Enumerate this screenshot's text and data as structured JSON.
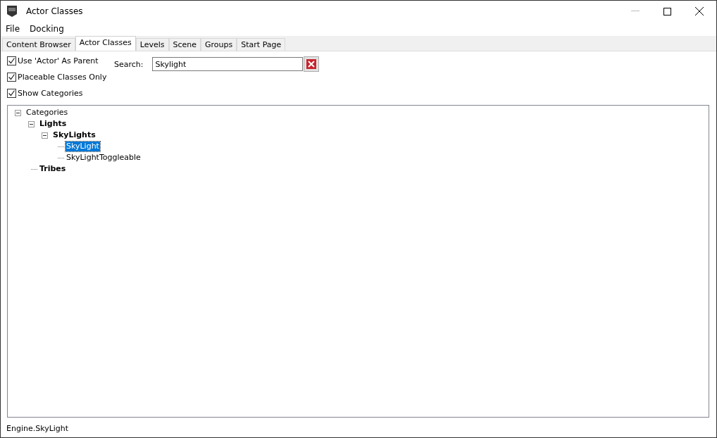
{
  "window": {
    "title": "Actor Classes"
  },
  "menu": [
    "File",
    "Docking"
  ],
  "tabs": [
    {
      "label": "Content Browser",
      "selected": false
    },
    {
      "label": "Actor Classes",
      "selected": true
    },
    {
      "label": "Levels",
      "selected": false
    },
    {
      "label": "Scene",
      "selected": false
    },
    {
      "label": "Groups",
      "selected": false
    },
    {
      "label": "Start Page",
      "selected": false
    }
  ],
  "options": [
    {
      "label": "Use 'Actor' As Parent",
      "checked": true
    },
    {
      "label": "Placeable Classes Only",
      "checked": true
    },
    {
      "label": "Show Categories",
      "checked": true
    }
  ],
  "search": {
    "label": "Search:",
    "value": "Skylight"
  },
  "tree": [
    {
      "label": "Categories",
      "kind": "item",
      "expanded": true,
      "selected": false,
      "children": [
        {
          "label": "Lights",
          "kind": "category",
          "expanded": true,
          "selected": false,
          "children": [
            {
              "label": "SkyLights",
              "kind": "category",
              "expanded": true,
              "selected": false,
              "children": [
                {
                  "label": "SkyLight",
                  "kind": "item",
                  "selected": true
                },
                {
                  "label": "SkyLightToggleable",
                  "kind": "item",
                  "selected": false
                }
              ]
            }
          ]
        },
        {
          "label": "Tribes",
          "kind": "category",
          "selected": false
        }
      ]
    }
  ],
  "status_bar": "Engine.SkyLight"
}
